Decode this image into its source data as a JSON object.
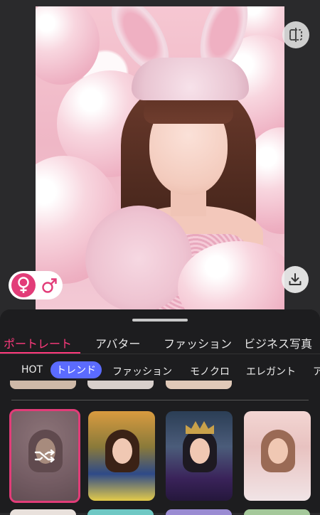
{
  "preview": {
    "compare_icon": "compare-split-icon",
    "download_icon": "download-icon"
  },
  "gender_toggle": {
    "female_symbol": "♀",
    "male_symbol": "♂",
    "selected": "female"
  },
  "main_tabs": [
    {
      "label": "ポートレート",
      "active": true
    },
    {
      "label": "アバター",
      "active": false
    },
    {
      "label": "ファッション",
      "active": false
    },
    {
      "label": "ビジネス写真",
      "active": false
    }
  ],
  "sub_tabs": [
    {
      "label": "HOT",
      "active": false
    },
    {
      "label": "トレンド",
      "active": true
    },
    {
      "label": "ファッション",
      "active": false
    },
    {
      "label": "モノクロ",
      "active": false
    },
    {
      "label": "エレガント",
      "active": false
    },
    {
      "label": "ア",
      "active": false
    }
  ],
  "templates": [
    {
      "id": "bunny-random",
      "selected": true,
      "overlay_icon": "shuffle-icon"
    },
    {
      "id": "princess-apple",
      "selected": false
    },
    {
      "id": "queen-crown",
      "selected": false
    },
    {
      "id": "angel-wings",
      "selected": false
    }
  ],
  "colors": {
    "accent_pink": "#e23c78",
    "active_tab_pink": "#ff3a7d",
    "subtab_active_blue": "#5b6bff",
    "sheet_bg": "#1d1d1f"
  }
}
